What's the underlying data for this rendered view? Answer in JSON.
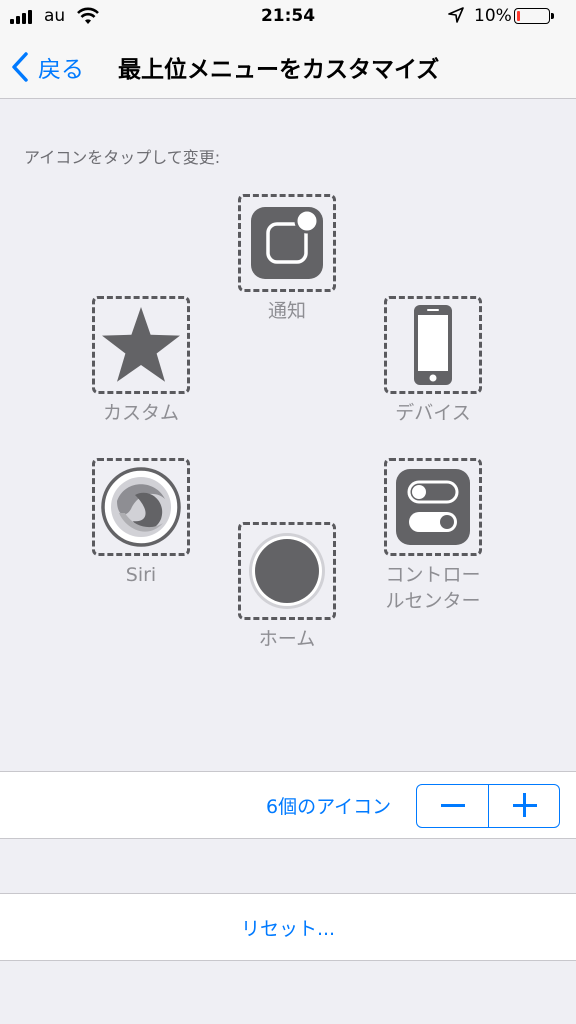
{
  "status_bar": {
    "carrier": "au",
    "time": "21:54",
    "battery_percent": "10%",
    "battery_level": 0.1,
    "icons": [
      "signal-icon",
      "wifi-icon",
      "location-icon",
      "battery-icon"
    ]
  },
  "nav": {
    "back_label": "戻る",
    "title": "最上位メニューをカスタマイズ"
  },
  "hint": "アイコンをタップして変更:",
  "menu_items": [
    {
      "id": "notifications",
      "label": "通知",
      "icon": "notification-icon"
    },
    {
      "id": "custom",
      "label": "カスタム",
      "icon": "star-icon"
    },
    {
      "id": "device",
      "label": "デバイス",
      "icon": "iphone-icon"
    },
    {
      "id": "siri",
      "label": "Siri",
      "icon": "siri-icon"
    },
    {
      "id": "control-center",
      "label": "コントロールセンター",
      "icon": "control-center-icon"
    },
    {
      "id": "home",
      "label": "ホーム",
      "icon": "home-button-icon"
    }
  ],
  "count": {
    "label": "6個のアイコン",
    "minus": "−",
    "plus": "+"
  },
  "reset_label": "リセット..."
}
